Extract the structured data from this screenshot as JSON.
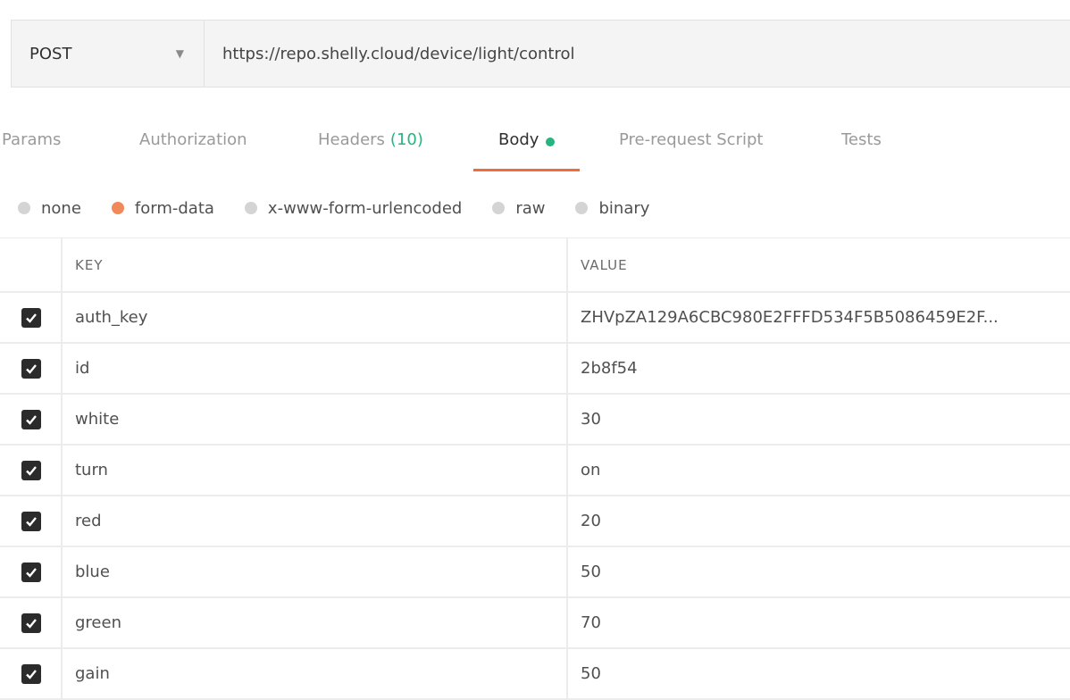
{
  "request": {
    "method": "POST",
    "url": "https://repo.shelly.cloud/device/light/control"
  },
  "tabs": [
    {
      "label": "Params"
    },
    {
      "label": "Authorization"
    },
    {
      "label": "Headers",
      "count": "(10)"
    },
    {
      "label": "Body",
      "active": true,
      "indicator": "green-dot"
    },
    {
      "label": "Pre-request Script"
    },
    {
      "label": "Tests"
    }
  ],
  "body_types": [
    {
      "label": "none"
    },
    {
      "label": "form-data",
      "selected": true
    },
    {
      "label": "x-www-form-urlencoded"
    },
    {
      "label": "raw"
    },
    {
      "label": "binary"
    }
  ],
  "table": {
    "columns": {
      "key": "KEY",
      "value": "VALUE"
    },
    "rows": [
      {
        "key": "auth_key",
        "value": "ZHVpZA129A6CBC980E2FFFD534F5B5086459E2F...",
        "checked": true
      },
      {
        "key": "id",
        "value": "2b8f54",
        "checked": true
      },
      {
        "key": "white",
        "value": "30",
        "checked": true
      },
      {
        "key": "turn",
        "value": "on",
        "checked": true
      },
      {
        "key": "red",
        "value": "20",
        "checked": true
      },
      {
        "key": "blue",
        "value": "50",
        "checked": true
      },
      {
        "key": "green",
        "value": "70",
        "checked": true
      },
      {
        "key": "gain",
        "value": "50",
        "checked": true
      }
    ]
  },
  "colors": {
    "accent": "#f26b3a",
    "status_green": "#26b47f",
    "checkbox": "#2b2b2b"
  },
  "icons": {
    "method_dropdown": "chevron-down-icon",
    "checkbox": "checkmark-icon"
  }
}
